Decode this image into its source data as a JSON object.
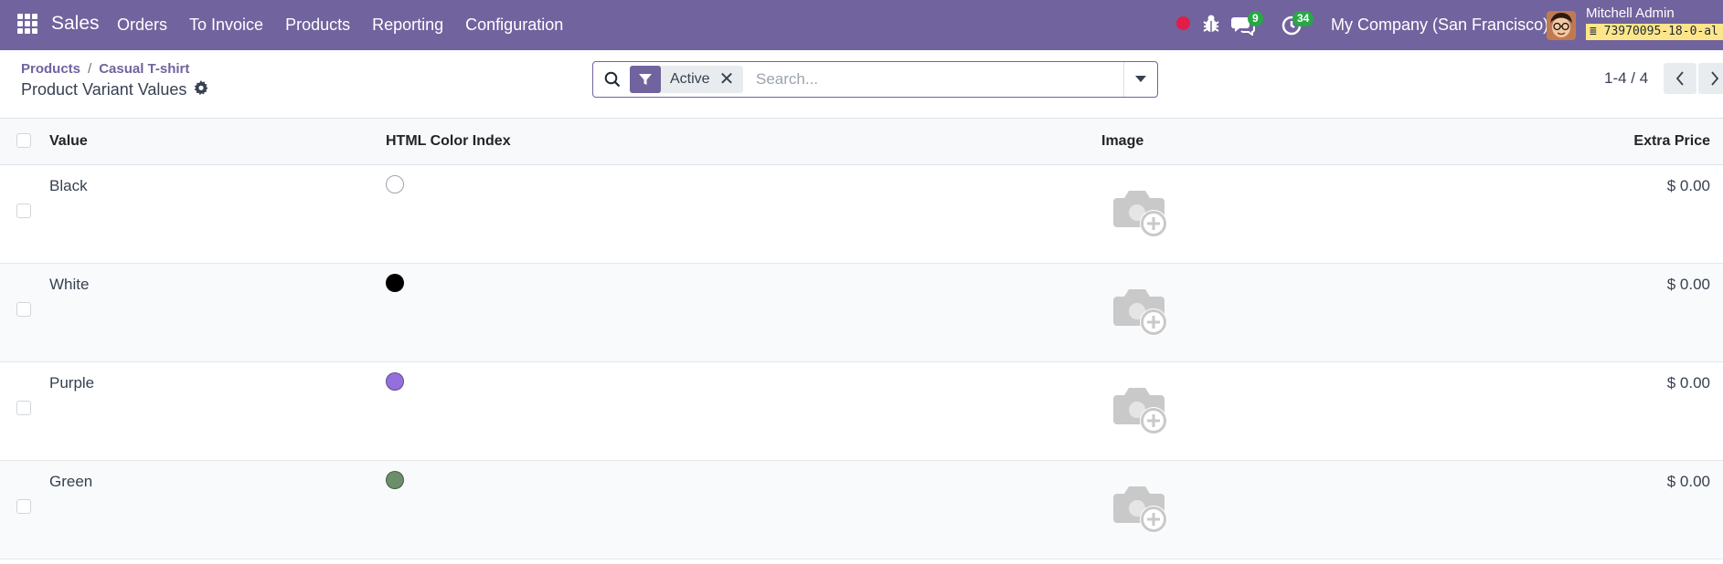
{
  "navbar": {
    "brand": "Sales",
    "menu": [
      "Orders",
      "To Invoice",
      "Products",
      "Reporting",
      "Configuration"
    ],
    "messages_count": "9",
    "activities_count": "34",
    "company": "My Company (San Francisco)",
    "user_name": "Mitchell Admin",
    "database": "73970095-18-0-al"
  },
  "breadcrumb": {
    "items": [
      "Products",
      "Casual T-shirt"
    ]
  },
  "page_title": "Product Variant Values",
  "search": {
    "facet_label": "Active",
    "placeholder": "Search..."
  },
  "pager": {
    "value": "1-4 / 4"
  },
  "table": {
    "headers": {
      "value": "Value",
      "color": "HTML Color Index",
      "image": "Image",
      "price": "Extra Price"
    },
    "rows": [
      {
        "value": "Black",
        "color": "none",
        "price": "$ 0.00"
      },
      {
        "value": "White",
        "color": "#000000",
        "price": "$ 0.00"
      },
      {
        "value": "Purple",
        "color": "#9370db",
        "price": "$ 0.00"
      },
      {
        "value": "Green",
        "color": "#6b8e6b",
        "price": "$ 0.00"
      }
    ]
  },
  "colors": {
    "brand": "#71639e",
    "badge": "#28a745",
    "record_dot": "#e11d48"
  }
}
